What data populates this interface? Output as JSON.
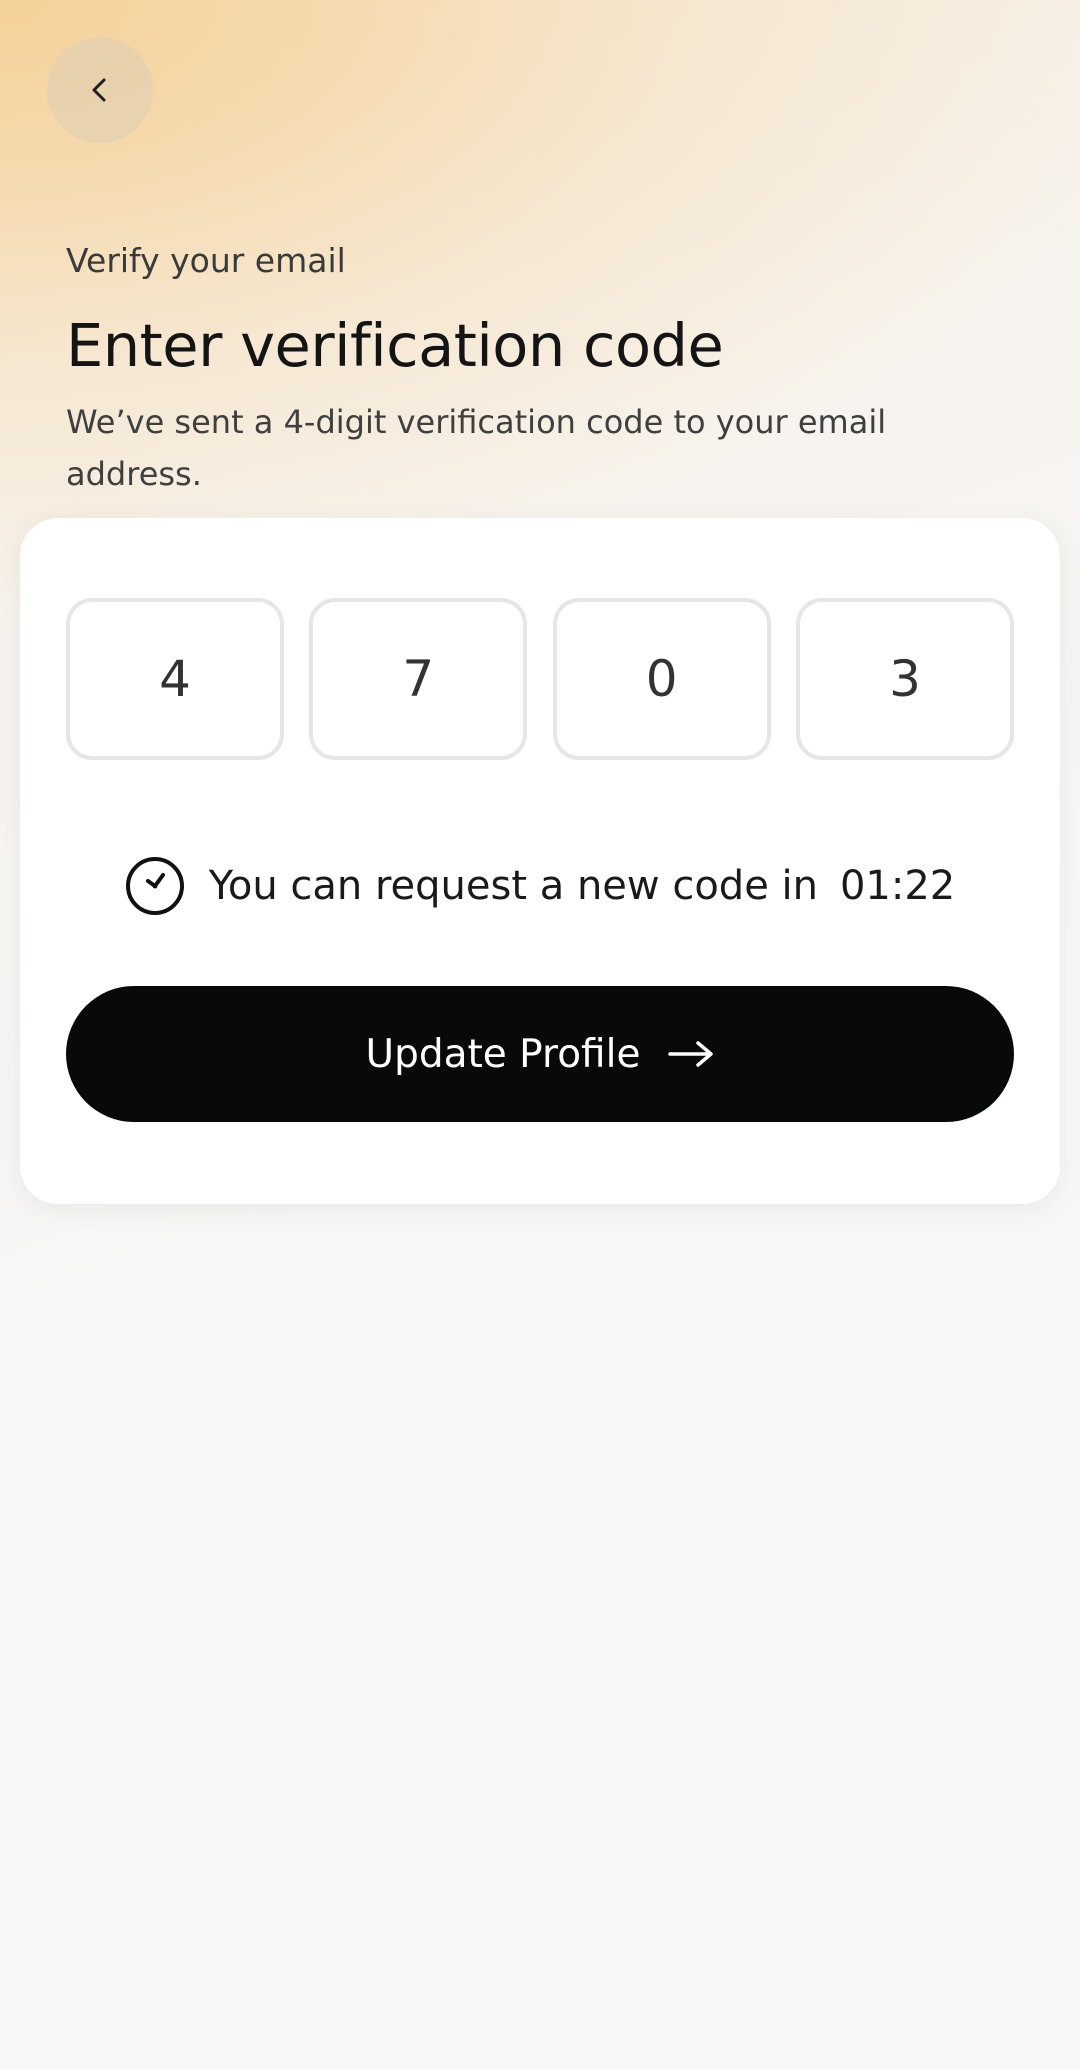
{
  "header": {
    "eyebrow": "Verify your email",
    "title": "Enter verification code",
    "subtitle": "We’ve sent a 4-digit verification code to your email address."
  },
  "code": {
    "digits": [
      "4",
      "7",
      "0",
      "3"
    ]
  },
  "timer": {
    "message": "You can request a new code in",
    "value": "01:22"
  },
  "primary_button": {
    "label": "Update Profile"
  },
  "icons": {
    "back": "chevron-left-icon",
    "timer": "clock-icon",
    "cta": "arrow-right-icon"
  },
  "colors": {
    "button_bg": "#080a0a",
    "accent_gradient": "#f5d096"
  }
}
